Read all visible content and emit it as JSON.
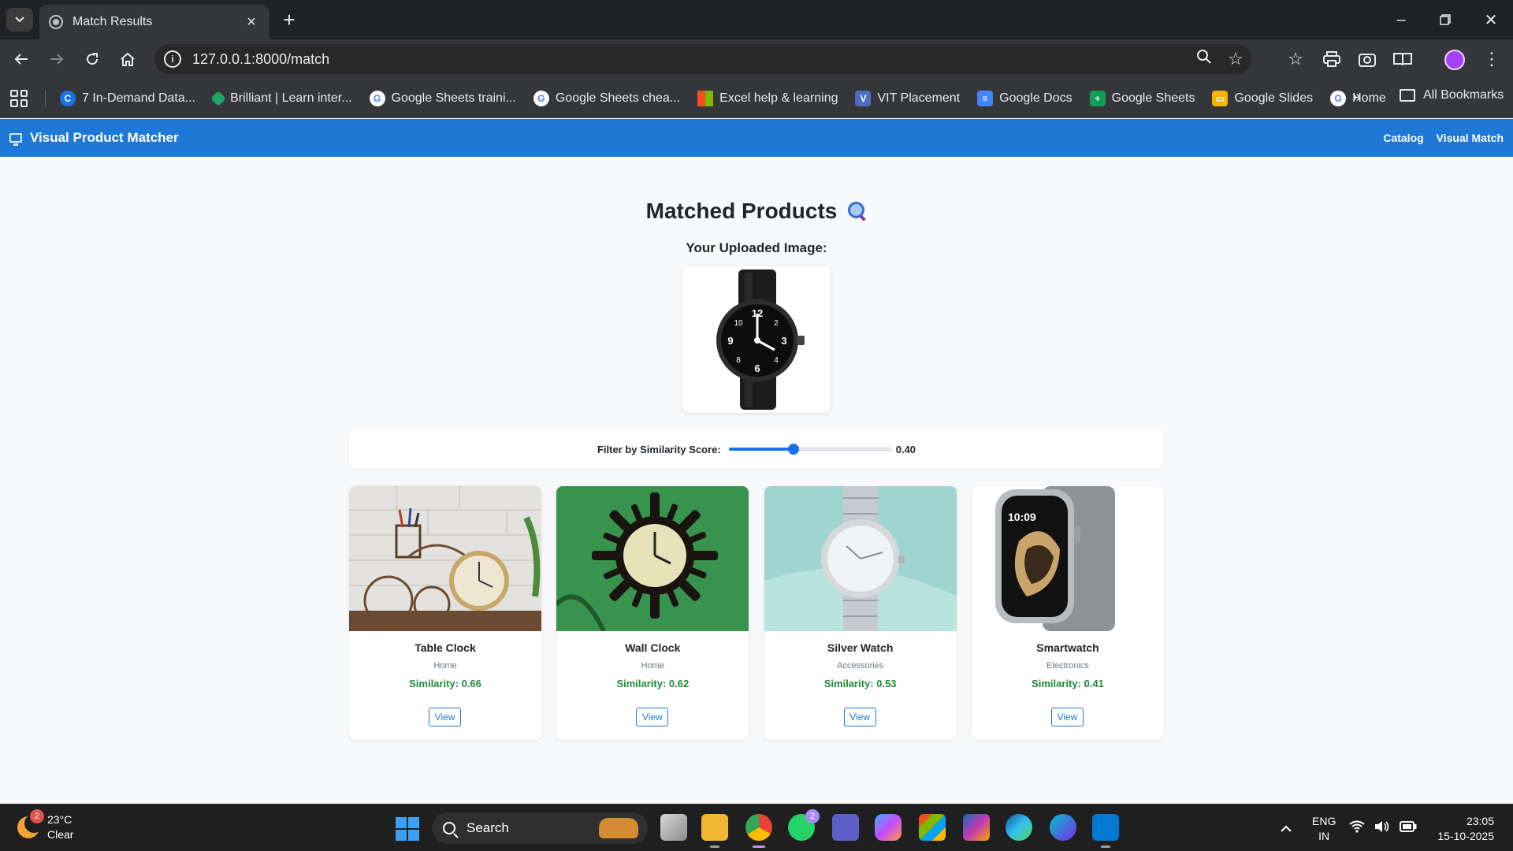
{
  "browser": {
    "tab_title": "Match Results",
    "url": "127.0.0.1:8000/match",
    "bookmarks": [
      {
        "label": "7 In-Demand Data...",
        "icon": "c-icon",
        "color": "#1a73e8"
      },
      {
        "label": "Brilliant | Learn inter...",
        "icon": "brilliant-icon",
        "color": "#1fa463"
      },
      {
        "label": "Google Sheets traini...",
        "icon": "google-icon",
        "color": "#ffffff"
      },
      {
        "label": "Google Sheets chea...",
        "icon": "google-icon",
        "color": "#ffffff"
      },
      {
        "label": "Excel help & learning",
        "icon": "microsoft-icon",
        "color": "#f25022"
      },
      {
        "label": "VIT Placement",
        "icon": "vit-icon",
        "color": "#4f6cbf"
      },
      {
        "label": "Google Docs",
        "icon": "docs-icon",
        "color": "#4285f4"
      },
      {
        "label": "Google Sheets",
        "icon": "sheets-icon",
        "color": "#0f9d58"
      },
      {
        "label": "Google Slides",
        "icon": "slides-icon",
        "color": "#f4b400"
      },
      {
        "label": "Home",
        "icon": "google-icon",
        "color": "#ffffff"
      }
    ],
    "all_bookmarks": "All Bookmarks"
  },
  "app": {
    "brand": "Visual Product Matcher",
    "nav": [
      "Catalog",
      "Visual Match"
    ],
    "accent": "#1e78d6"
  },
  "page": {
    "title": "Matched Products",
    "upload_label": "Your Uploaded Image:",
    "filter_label": "Filter by Similarity Score:",
    "filter_value": "0.40",
    "filter_level": 0.4
  },
  "products": [
    {
      "name": "Table Clock",
      "category": "Home",
      "similarity": "Similarity: 0.66",
      "button": "View"
    },
    {
      "name": "Wall Clock",
      "category": "Home",
      "similarity": "Similarity: 0.62",
      "button": "View"
    },
    {
      "name": "Silver Watch",
      "category": "Accessories",
      "similarity": "Similarity: 0.53",
      "button": "View"
    },
    {
      "name": "Smartwatch",
      "category": "Electronics",
      "similarity": "Similarity: 0.41",
      "button": "View"
    }
  ],
  "taskbar": {
    "weather_badge": "2",
    "temperature": "23°C",
    "condition": "Clear",
    "search": "Search",
    "whatsapp_badge": "2",
    "lang_line1": "ENG",
    "lang_line2": "IN",
    "time": "23:05",
    "date": "15-10-2025"
  }
}
